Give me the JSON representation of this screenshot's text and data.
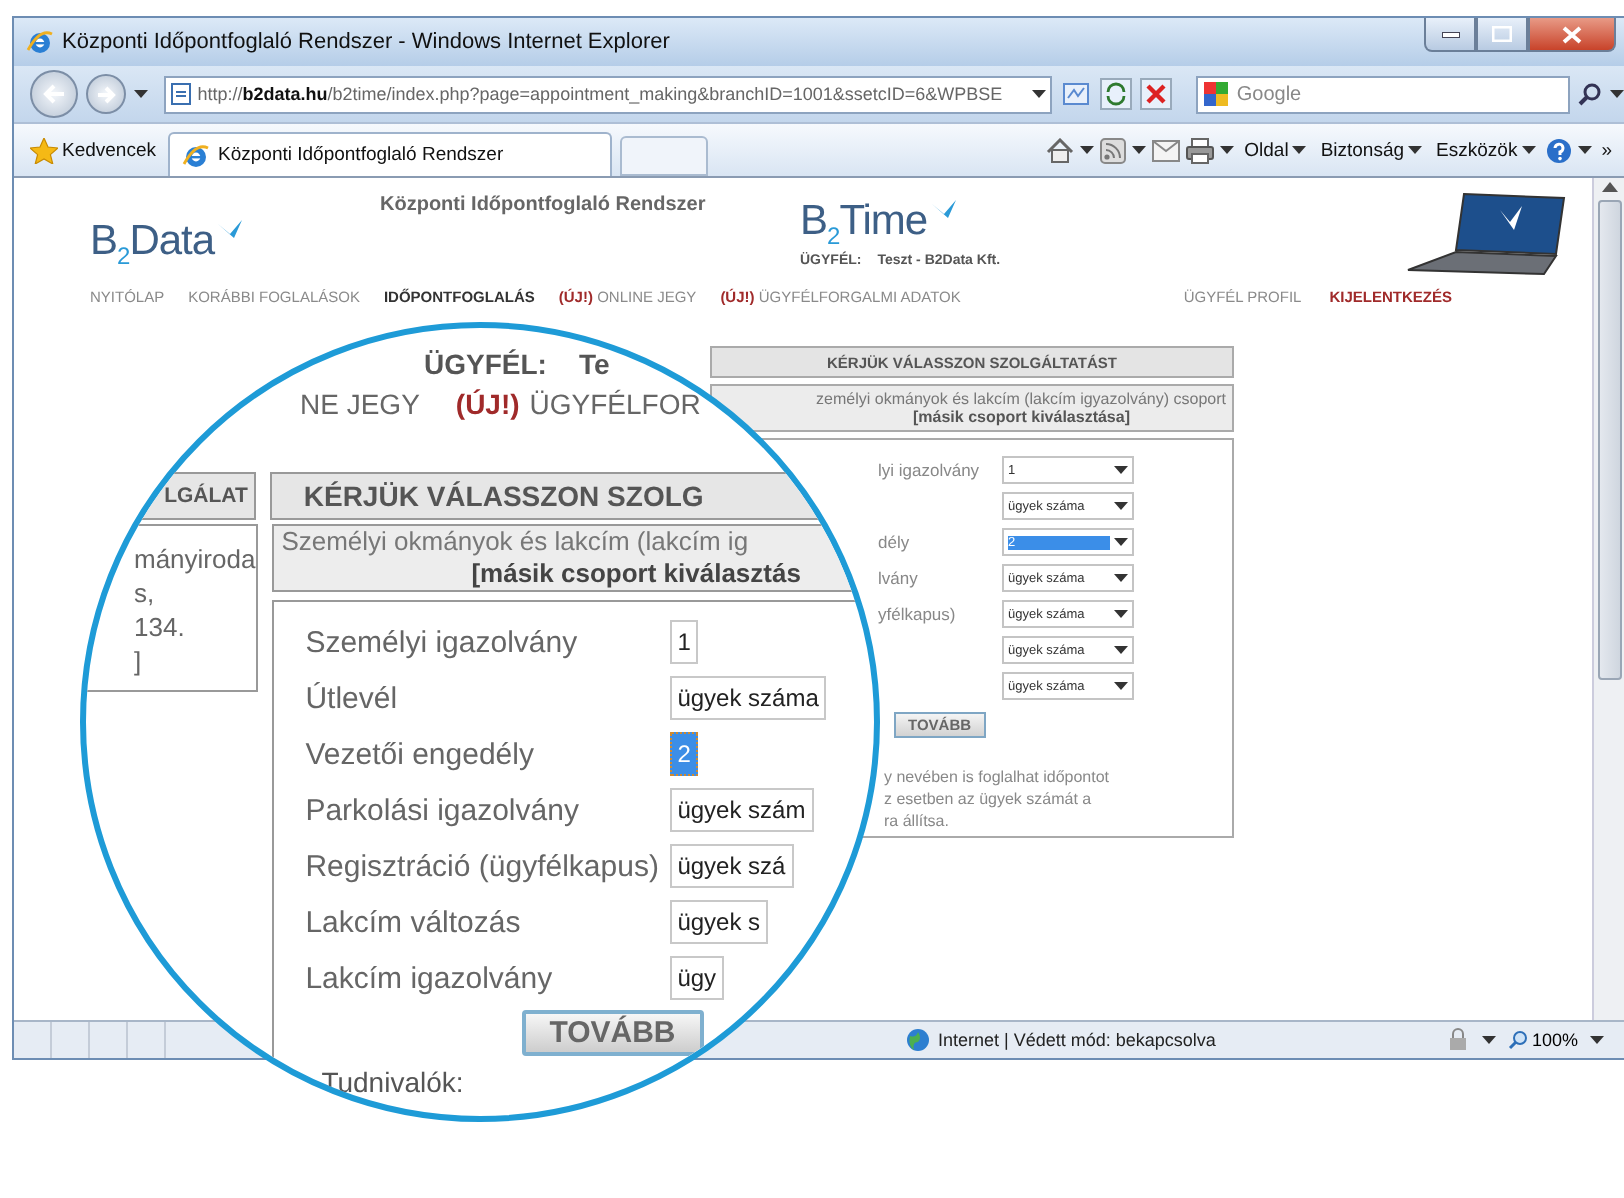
{
  "window": {
    "title": "Központi Időpontfoglaló Rendszer - Windows Internet Explorer"
  },
  "address_bar": {
    "url": "http://**b2data.hu**/b2time/index.php?page=appointment_making&branchID=1001&ssetcID=6&WPBSE"
  },
  "search_field": {
    "placeholder": "Google"
  },
  "favorites_bar": {
    "favorites": "Kedvencek",
    "tabs": [
      {
        "label": "Központi Időpontfoglaló Rendszer",
        "selected": true
      }
    ],
    "commands": [
      "Oldal",
      "Biztonság",
      "Eszközök"
    ],
    "overflow": "»"
  },
  "page": {
    "logo": "B$_{2}$Data",
    "system_title": "Központi Időpontfoglaló Rendszer",
    "product_logo": "B$_{2}$Time",
    "client_label": "ÜGYFÉL:",
    "client_name": "Teszt - B2Data Kft.",
    "nav": [
      {
        "label": "NYITÓLAP",
        "selected": false
      },
      {
        "label": "KORÁBBI FOGLALÁSOK",
        "selected": false
      },
      {
        "label": "IDŐPONTFOGLALÁS",
        "selected": true
      },
      {
        "badge": "(ÚJ!)",
        "label": "ONLINE JEGY",
        "selected": false
      },
      {
        "badge": "(ÚJ!)",
        "label": "ÜGYFÉLFORGALMI ADATOK",
        "selected": false
      }
    ],
    "account_nav": [
      {
        "label": "ÜGYFÉL PROFIL",
        "kind": "link"
      },
      {
        "label": "KIJELENTKEZÉS",
        "kind": "logout"
      }
    ],
    "service_panel": {
      "heading": "KÉRJÜK VÁLASSZON SZOLGÁLTATÁST",
      "group_title": "zemélyi okmányok és lakcím (lakcím igyazolvány) csoport",
      "group_link": "[másik csoport kiválasztása]",
      "rows": [
        {
          "label": "lyi igazolvány",
          "value": "1",
          "selected": false
        },
        {
          "value": "ügyek száma",
          "selected": false
        },
        {
          "label": "dély",
          "value": "2",
          "selected": true
        },
        {
          "label": "lvány",
          "value": "ügyek száma",
          "selected": false
        },
        {
          "label": "yfélkapus)",
          "value": "ügyek száma",
          "selected": false
        },
        {
          "value": "ügyek száma",
          "selected": false
        },
        {
          "value": "ügyek száma",
          "selected": false
        }
      ],
      "button": "TOVÁBB",
      "notes": [
        "y nevében is foglalhat időpontot",
        "z esetben az ügyek számát a",
        "ra állítsa."
      ]
    }
  },
  "magnifier": {
    "client_label": "ÜGYFÉL:",
    "client_name": "Te",
    "nav": [
      {
        "label": "NE JEGY"
      },
      {
        "badge": "(ÚJ!)",
        "label": "ÜGYFÉLFOR"
      }
    ],
    "side_heading": "LGÁLAT",
    "heading": "KÉRJÜK VÁLASSZON SZOLG",
    "office_lines": [
      "mányiroda",
      "s,",
      "134.",
      "]"
    ],
    "group_title": "Személyi okmányok és lakcím (lakcím ig",
    "group_link": "[másik csoport kiválasztás",
    "rows": [
      {
        "label": "Személyi igazolvány",
        "value": "1",
        "selected": false
      },
      {
        "label": "Útlevél",
        "value": "ügyek száma",
        "selected": false
      },
      {
        "label": "Vezetői engedély",
        "value": "2",
        "selected": true
      },
      {
        "label": "Parkolási igazolvány",
        "value": "ügyek szám",
        "selected": false
      },
      {
        "label": "Regisztráció (ügyfélkapus)",
        "value": "ügyek szá",
        "selected": false
      },
      {
        "label": "Lakcím változás",
        "value": "ügyek s",
        "selected": false
      },
      {
        "label": "Lakcím igazolvány",
        "value": "ügy",
        "selected": false
      }
    ],
    "button": "TOVÁBB",
    "notes_title": "Tudnivalók:"
  },
  "status_bar": {
    "zone": "Internet | Védett mód: bekapcsolva",
    "zoom": "100%"
  }
}
